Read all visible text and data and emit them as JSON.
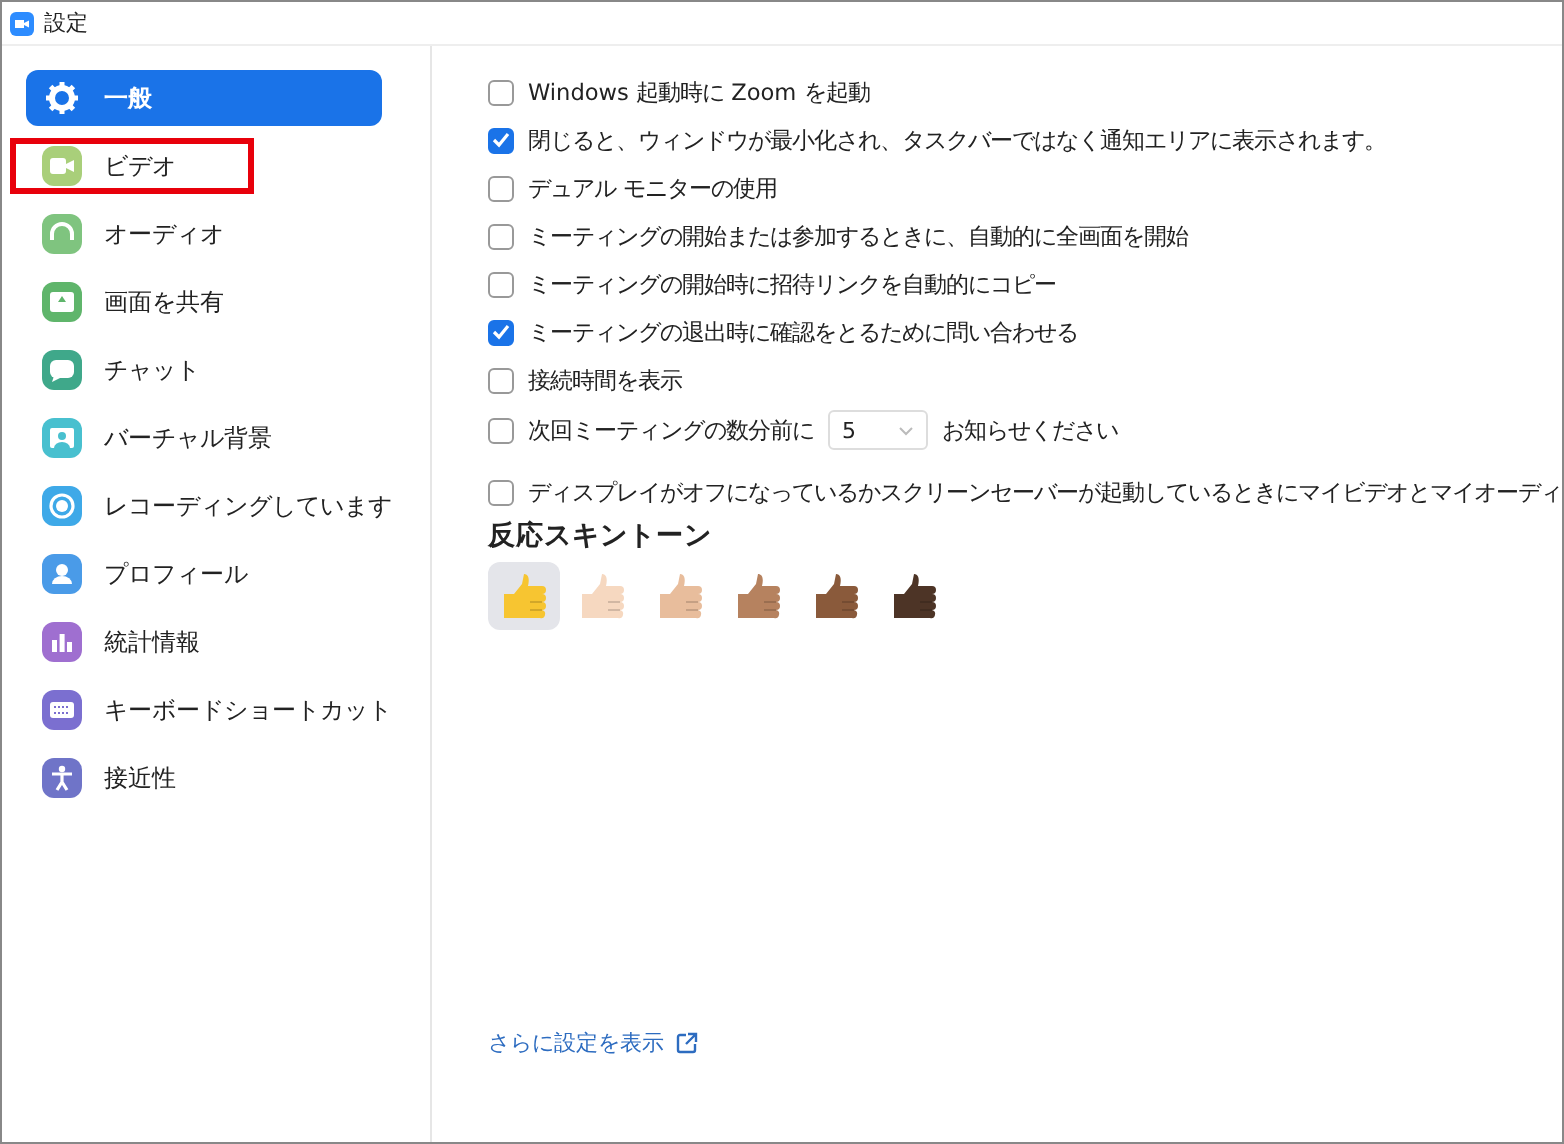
{
  "window": {
    "title": "設定"
  },
  "sidebar": {
    "items": [
      {
        "label": "一般",
        "kind": "gear",
        "color": "#ffffff",
        "selected": true,
        "highlighted": false
      },
      {
        "label": "ビデオ",
        "kind": "video",
        "color": "#a9cf7a",
        "selected": false,
        "highlighted": true
      },
      {
        "label": "オーディオ",
        "kind": "headphones",
        "color": "#7fc47f",
        "selected": false,
        "highlighted": false
      },
      {
        "label": "画面を共有",
        "kind": "share",
        "color": "#5fb56b",
        "selected": false,
        "highlighted": false
      },
      {
        "label": "チャット",
        "kind": "chat",
        "color": "#3fa88a",
        "selected": false,
        "highlighted": false
      },
      {
        "label": "バーチャル背景",
        "kind": "background",
        "color": "#48c0cf",
        "selected": false,
        "highlighted": false
      },
      {
        "label": "レコーディングしています",
        "kind": "record",
        "color": "#3ea9e8",
        "selected": false,
        "highlighted": false
      },
      {
        "label": "プロフィール",
        "kind": "profile",
        "color": "#4a9be8",
        "selected": false,
        "highlighted": false
      },
      {
        "label": "統計情報",
        "kind": "stats",
        "color": "#9f6fd0",
        "selected": false,
        "highlighted": false
      },
      {
        "label": "キーボードショートカット",
        "kind": "keyboard",
        "color": "#7b6fd0",
        "selected": false,
        "highlighted": false
      },
      {
        "label": "接近性",
        "kind": "accessibility",
        "color": "#6f74c8",
        "selected": false,
        "highlighted": false
      }
    ]
  },
  "options": [
    {
      "kind": "text",
      "label": "Windows 起動時に Zoom を起動",
      "checked": false
    },
    {
      "kind": "text",
      "label": "閉じると、ウィンドウが最小化され、タスクバーではなく通知エリアに表示されます。",
      "checked": true
    },
    {
      "kind": "text",
      "label": "デュアル モニターの使用",
      "checked": false
    },
    {
      "kind": "text",
      "label": "ミーティングの開始または参加するときに、自動的に全画面を開始",
      "checked": false
    },
    {
      "kind": "text",
      "label": "ミーティングの開始時に招待リンクを自動的にコピー",
      "checked": false
    },
    {
      "kind": "text",
      "label": "ミーティングの退出時に確認をとるために問い合わせる",
      "checked": true
    },
    {
      "kind": "text",
      "label": "接続時間を表示",
      "checked": false
    },
    {
      "kind": "select",
      "label": "次回ミーティングの数分前に",
      "value": "5",
      "suffix": "お知らせください",
      "checked": false
    },
    {
      "kind": "text",
      "label": "ディスプレイがオフになっているかスクリーンセーバーが起動しているときにマイビデオとマイオーディ",
      "checked": false
    }
  ],
  "skin_tone": {
    "heading": "反応スキントーン",
    "tones": [
      {
        "color": "#f7c531",
        "selected": true
      },
      {
        "color": "#f6d8c0",
        "selected": false
      },
      {
        "color": "#e8bd9c",
        "selected": false
      },
      {
        "color": "#b6825f",
        "selected": false
      },
      {
        "color": "#8a5a3b",
        "selected": false
      },
      {
        "color": "#4d3426",
        "selected": false
      }
    ]
  },
  "more_link": "さらに設定を表示"
}
